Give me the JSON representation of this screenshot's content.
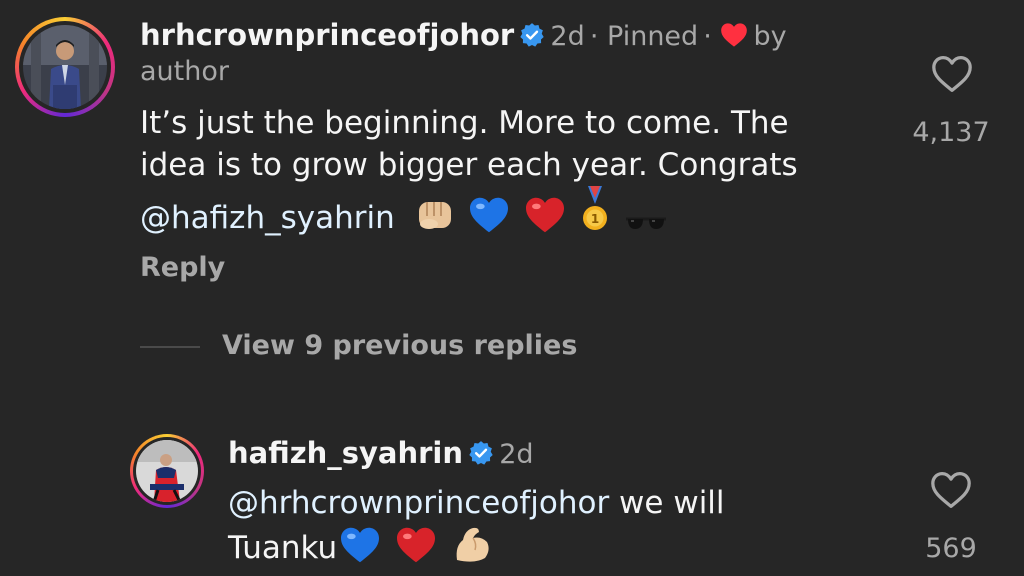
{
  "pinned_comment": {
    "username": "hrhcrownprinceofjohor",
    "time": "2d",
    "pinned_label": "Pinned",
    "liked_by": "by",
    "liked_by_who": "author",
    "text_lines": [
      "It’s just the beginning. More to come. The",
      "idea is to grow bigger each year. Congrats"
    ],
    "mention": "@hafizh_syahrin",
    "emojis": [
      "fist-emoji",
      "blue-heart-emoji",
      "red-heart-emoji",
      "medal-emoji",
      "sunglasses-emoji"
    ],
    "reply_label": "Reply",
    "like_count": "4,137"
  },
  "view_replies_label": "View 9 previous replies",
  "reply_comment": {
    "username": "hafizh_syahrin",
    "time": "2d",
    "mention": "@hrhcrownprinceofjohor",
    "text_after_mention": " we will",
    "text_line2": "Tuanku",
    "emojis": [
      "blue-heart-emoji",
      "red-heart-emoji",
      "flexed-bicep-emoji"
    ],
    "like_count": "569"
  },
  "colors": {
    "background": "#262626",
    "primary_text": "#f5f5f5",
    "secondary_text": "#a8a8a8",
    "verified_blue": "#3897f0",
    "heart_red": "#ff3040"
  }
}
